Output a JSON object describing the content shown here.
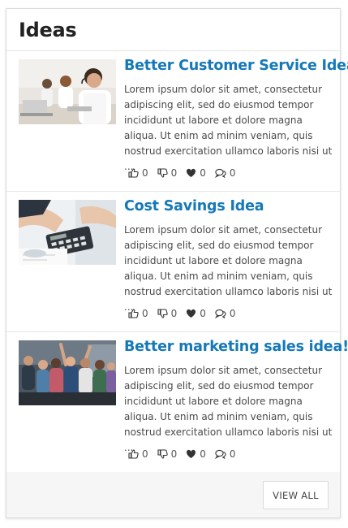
{
  "widget": {
    "title": "Ideas",
    "view_all_label": "VIEW ALL"
  },
  "ideas": [
    {
      "title": "Better Customer Service Idea",
      "excerpt": "Lorem ipsum dolor sit amet, consectetur adipiscing elit, sed do eiusmod tempor incididunt ut labore et dolore magna aliqua. Ut enim ad minim veniam, quis nostrud exercitation ullamco laboris nisi ut ...",
      "likes": "0",
      "dislikes": "0",
      "favorites": "0",
      "comments": "0",
      "image": "call-center-photo"
    },
    {
      "title": "Cost Savings Idea",
      "excerpt": "Lorem ipsum dolor sit amet, consectetur adipiscing elit, sed do eiusmod tempor incididunt ut labore et dolore magna aliqua. Ut enim ad minim veniam, quis nostrud exercitation ullamco laboris nisi ut ...",
      "likes": "0",
      "dislikes": "0",
      "favorites": "0",
      "comments": "0",
      "image": "calculator-photo"
    },
    {
      "title": "Better marketing sales idea!",
      "excerpt": "Lorem ipsum dolor sit amet, consectetur adipiscing elit, sed do eiusmod tempor incididunt ut labore et dolore magna aliqua. Ut enim ad minim veniam, quis nostrud exercitation ullamco laboris nisi ut ...",
      "likes": "0",
      "dislikes": "0",
      "favorites": "0",
      "comments": "0",
      "image": "team-celebration-photo"
    }
  ],
  "colors": {
    "title_link": "#1579b8",
    "body_text": "#4a4a4a"
  }
}
